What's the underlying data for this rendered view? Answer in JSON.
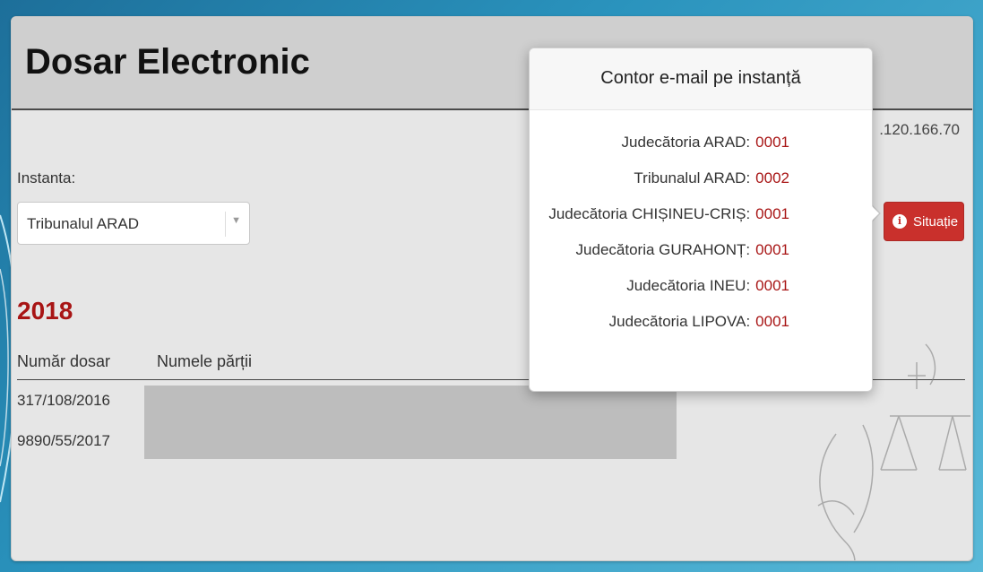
{
  "header": {
    "title": "Dosar Electronic",
    "ip": ".120.166.70"
  },
  "form": {
    "instanta_label": "Instanta:",
    "selected": "Tribunalul ARAD"
  },
  "situatie_button": {
    "label": "Situație"
  },
  "popover": {
    "title": "Contor e-mail pe instanță",
    "rows": [
      {
        "name": "Judecătoria ARAD:",
        "count": "0001"
      },
      {
        "name": "Tribunalul ARAD:",
        "count": "0002"
      },
      {
        "name": "Judecătoria CHIȘINEU-CRIȘ:",
        "count": "0001"
      },
      {
        "name": "Judecătoria GURAHONȚ:",
        "count": "0001"
      },
      {
        "name": "Judecătoria INEU:",
        "count": "0001"
      },
      {
        "name": "Judecătoria LIPOVA:",
        "count": "0001"
      }
    ]
  },
  "section": {
    "year": "2018",
    "columns": [
      "Număr dosar",
      "Numele părții"
    ],
    "rows": [
      {
        "numar": "317/108/2016"
      },
      {
        "numar": "9890/55/2017"
      }
    ]
  },
  "colors": {
    "accent_red": "#a81515",
    "button_red": "#c9302c",
    "frame_blue": "#2a93bd"
  },
  "icons": {
    "info": "info-circle-icon",
    "dropdown": "caret-down-icon",
    "watermark": "justice-scales-icon"
  }
}
